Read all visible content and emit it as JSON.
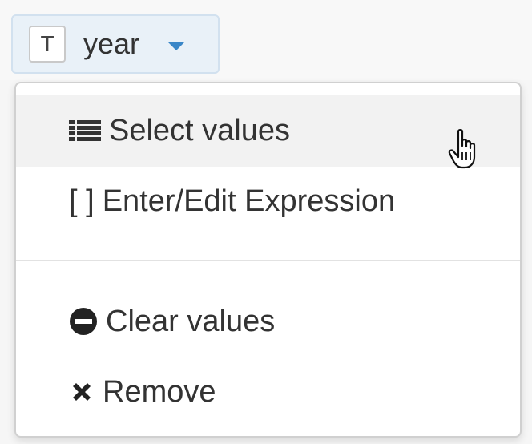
{
  "field": {
    "type_badge": "T",
    "name": "year",
    "caret_icon": "caret-down-icon",
    "accent_color": "#3a87c8"
  },
  "menu": {
    "items": [
      {
        "label": "Select values",
        "icon": "list-icon",
        "hovered": true
      },
      {
        "label": "Enter/Edit Expression",
        "icon": "brackets-icon",
        "icon_text": "[ ]"
      },
      {
        "label": "Clear values",
        "icon": "minus-circle-icon"
      },
      {
        "label": "Remove",
        "icon": "close-icon"
      }
    ]
  },
  "cursor": "hand-pointer-icon"
}
